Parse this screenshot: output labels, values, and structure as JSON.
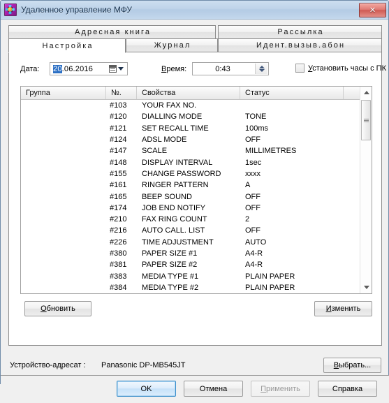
{
  "window": {
    "title": "Удаленное управление МФУ",
    "app_icon": "printer-app-icon",
    "close_label": "✕"
  },
  "tabs": [
    {
      "key": "address_book",
      "label": "Адресная книга",
      "active": false
    },
    {
      "key": "distribution",
      "label": "Рассылка",
      "active": false
    },
    {
      "key": "settings",
      "label": "Настройка",
      "active": true
    },
    {
      "key": "journal",
      "label": "Журнал",
      "active": false
    },
    {
      "key": "caller_id",
      "label": "Идент.вызыв.абон",
      "active": false
    }
  ],
  "form": {
    "date_label": "Дата:",
    "date_selected": "20",
    "date_rest": ".06.2016",
    "date_value": "20.06.2016",
    "calendar_icon": "calendar-icon",
    "dropdown_icon": "chevron-down-icon",
    "time_label": "Время:",
    "time_value": "0:43",
    "spinner_icon": "spinner-updown-icon",
    "sync_checkbox_label": "Установить часы с ПК",
    "sync_checkbox_checked": false
  },
  "table": {
    "columns": [
      "Группа",
      "№.",
      "Свойства",
      "Статус",
      ""
    ],
    "rows": [
      {
        "group": "",
        "no": "#103",
        "property": "YOUR FAX NO.",
        "status": ""
      },
      {
        "group": "",
        "no": "#120",
        "property": "DIALLING MODE",
        "status": "TONE"
      },
      {
        "group": "",
        "no": "#121",
        "property": "SET RECALL TIME",
        "status": "100ms"
      },
      {
        "group": "",
        "no": "#124",
        "property": "ADSL MODE",
        "status": "OFF"
      },
      {
        "group": "",
        "no": "#147",
        "property": "SCALE",
        "status": "MILLIMETRES"
      },
      {
        "group": "",
        "no": "#148",
        "property": "DISPLAY INTERVAL",
        "status": "1sec"
      },
      {
        "group": "",
        "no": "#155",
        "property": "CHANGE PASSWORD",
        "status": "xxxx"
      },
      {
        "group": "",
        "no": "#161",
        "property": "RINGER PATTERN",
        "status": "A"
      },
      {
        "group": "",
        "no": "#165",
        "property": "BEEP SOUND",
        "status": "OFF"
      },
      {
        "group": "",
        "no": "#174",
        "property": "JOB END NOTIFY",
        "status": "OFF"
      },
      {
        "group": "",
        "no": "#210",
        "property": "FAX RING COUNT",
        "status": "2"
      },
      {
        "group": "",
        "no": "#216",
        "property": "AUTO CALL. LIST",
        "status": "OFF"
      },
      {
        "group": "",
        "no": "#226",
        "property": "TIME ADJUSTMENT",
        "status": "AUTO"
      },
      {
        "group": "",
        "no": "#380",
        "property": "PAPER SIZE #1",
        "status": "A4-R"
      },
      {
        "group": "",
        "no": "#381",
        "property": "PAPER SIZE #2",
        "status": "A4-R"
      },
      {
        "group": "",
        "no": "#383",
        "property": "MEDIA TYPE #1",
        "status": "PLAIN PAPER"
      },
      {
        "group": "",
        "no": "#384",
        "property": "MEDIA TYPE #2",
        "status": "PLAIN PAPER"
      }
    ],
    "scrollbar": {
      "up_icon": "scroll-up-arrow-icon",
      "down_icon": "scroll-down-arrow-icon",
      "thumb_icon": "scroll-thumb"
    }
  },
  "page_buttons": {
    "refresh": "Обновить",
    "change": "Изменить"
  },
  "footer": {
    "device_label": "Устройство-адресат :",
    "device_value": "Panasonic DP-MB545JT",
    "select_button": "Выбрать..."
  },
  "command_bar": {
    "ok": "OK",
    "cancel": "Отмена",
    "apply": "Применить",
    "help": "Справка"
  }
}
